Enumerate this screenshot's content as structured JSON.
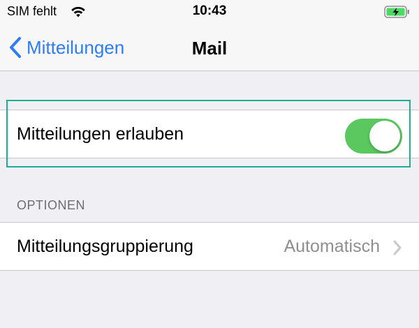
{
  "status_bar": {
    "carrier": "SIM fehlt",
    "time": "10:43"
  },
  "nav": {
    "back_label": "Mitteilungen",
    "title": "Mail"
  },
  "allow_cell": {
    "label": "Mitteilungen erlauben",
    "toggle_on": true
  },
  "options_section": {
    "header": "OPTIONEN",
    "items": [
      {
        "label": "Mitteilungsgruppierung",
        "value": "Automatisch"
      }
    ]
  },
  "colors": {
    "accent": "#2f7cf6",
    "toggle_on": "#5ac85f",
    "highlight": "#1fae94",
    "background": "#efeff4",
    "secondary_text": "#8e8e93"
  },
  "icons": [
    "wifi-icon",
    "battery-charging-icon",
    "back-chevron-icon",
    "chevron-right-icon"
  ]
}
